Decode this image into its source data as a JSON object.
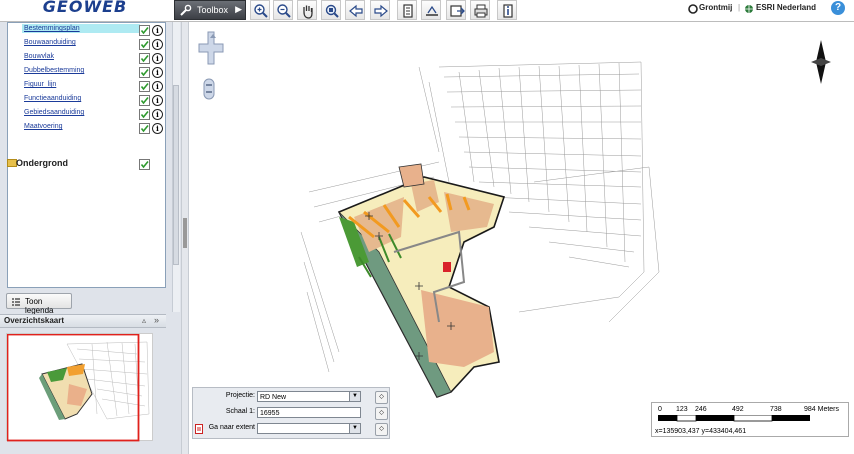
{
  "app": {
    "logo_text": "GEOWEB"
  },
  "toolbar": {
    "toolbox_label": "Toolbox",
    "brand_grontmij": "Grontmij",
    "brand_esri": "ESRI Nederland",
    "help_symbol": "?",
    "tools": [
      "zoom-in-icon",
      "zoom-out-icon",
      "pan-hand-icon",
      "zoom-extent-icon",
      "back-arrow-icon",
      "forward-arrow-icon",
      "identify-icon",
      "measure-icon",
      "export-icon",
      "print-icon",
      "info-icon"
    ]
  },
  "layers": {
    "items": [
      {
        "label": "Bestemmingsplan",
        "checked": true
      },
      {
        "label": "Bouwaanduiding",
        "checked": true
      },
      {
        "label": "Bouwvlak",
        "checked": true
      },
      {
        "label": "Dubbelbestemming",
        "checked": true
      },
      {
        "label": "Figuur_lijn",
        "checked": true
      },
      {
        "label": "Functieaanduiding",
        "checked": true
      },
      {
        "label": "Gebiedsaanduiding",
        "checked": true
      },
      {
        "label": "Maatvoering",
        "checked": true
      }
    ],
    "group_label": "Ondergrond",
    "info_symbol": "i"
  },
  "legend_button": {
    "label": "Toon legenda"
  },
  "overview": {
    "title": "Overzichtskaart"
  },
  "form": {
    "projection_label": "Projectie:",
    "projection_value": "RD New",
    "scale_label": "Schaal 1:",
    "scale_value": "16955",
    "extent_label": "Ga naar extent",
    "extent_value": ""
  },
  "scalebar": {
    "labels": [
      "0",
      "123",
      "246",
      "492",
      "738",
      "984 Meters"
    ],
    "coords": "x=135903,437 y=433404,461"
  },
  "colors": {
    "accent": "#3a8fd9",
    "selected_row": "#aeeaf2",
    "overview_frame": "#e0211c"
  }
}
